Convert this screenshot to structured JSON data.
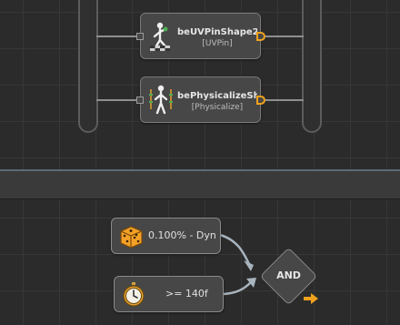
{
  "graph": {
    "nodes": [
      {
        "title": "beUVPinShape2",
        "subtitle": "[UVPin]",
        "icon": "uv-pin-figure-icon"
      },
      {
        "title": "bePhysicalizeSh...",
        "subtitle": "[Physicalize]",
        "icon": "physicalize-figure-icon"
      }
    ]
  },
  "conditions": {
    "random": {
      "label": "0.100% - Dyn",
      "icon": "dice-icon"
    },
    "timer": {
      "label": ">= 140f",
      "icon": "stopwatch-icon"
    },
    "and_label": "AND"
  },
  "colors": {
    "output_port": "#f0a21e",
    "node_bg": "#474747",
    "wire": "#8e8e8e",
    "dice": "#f2a127"
  }
}
